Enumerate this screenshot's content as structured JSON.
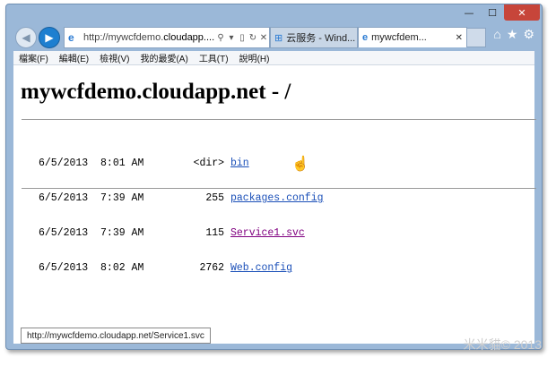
{
  "browser": {
    "address_prefix": "http://mywcfdemo.",
    "address_domain": "cloudapp....",
    "tabs": [
      {
        "label": "云服务 - Wind..."
      },
      {
        "label": "mywcfdem..."
      }
    ]
  },
  "menubar": {
    "items": [
      "檔案(F)",
      "編輯(E)",
      "檢視(V)",
      "我的最愛(A)",
      "工具(T)",
      "說明(H)"
    ]
  },
  "page": {
    "title": "mywcfdemo.cloudapp.net - /",
    "entries": [
      {
        "date": "6/5/2013",
        "time": "8:01 AM",
        "size": "<dir>",
        "name": "bin"
      },
      {
        "date": "6/5/2013",
        "time": "7:39 AM",
        "size": "255",
        "name": "packages.config"
      },
      {
        "date": "6/5/2013",
        "time": "7:39 AM",
        "size": "115",
        "name": "Service1.svc"
      },
      {
        "date": "6/5/2013",
        "time": "8:02 AM",
        "size": "2762",
        "name": "Web.config"
      }
    ]
  },
  "statusbar": {
    "url": "http://mywcfdemo.cloudapp.net/Service1.svc"
  },
  "watermark": "米米貓© 2013"
}
